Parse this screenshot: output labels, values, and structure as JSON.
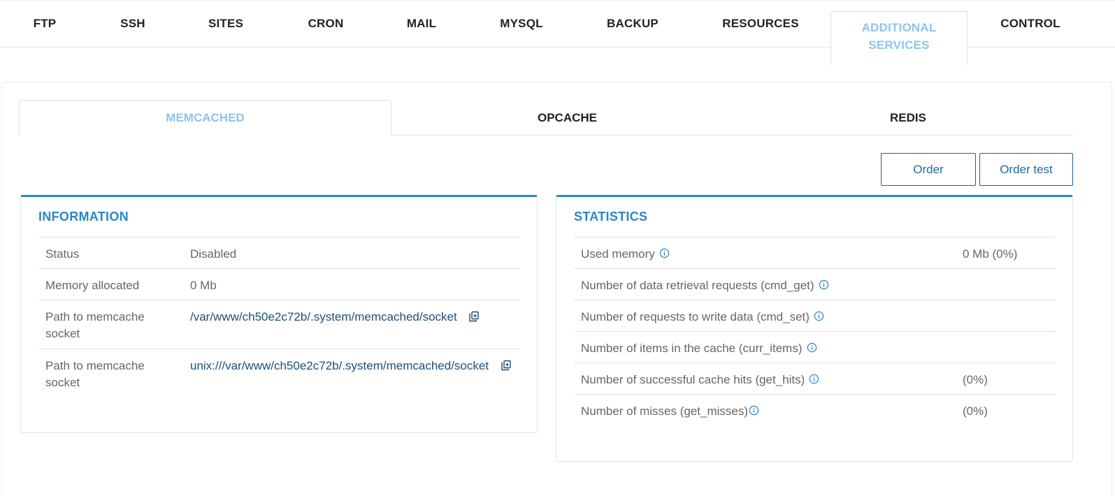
{
  "top_tabs": [
    {
      "label": "FTP"
    },
    {
      "label": "SSH"
    },
    {
      "label": "SITES"
    },
    {
      "label": "CRON"
    },
    {
      "label": "MAIL"
    },
    {
      "label": "MYSQL"
    },
    {
      "label": "BACKUP"
    },
    {
      "label": "RESOURCES"
    },
    {
      "label_line1": "ADDITIONAL",
      "label_line2": "SERVICES",
      "active": true
    },
    {
      "label": "CONTROL"
    }
  ],
  "sub_tabs": [
    {
      "label": "MEMCACHED",
      "active": true
    },
    {
      "label": "OPCACHE"
    },
    {
      "label": "REDIS"
    }
  ],
  "actions": {
    "order_label": "Order",
    "order_test_label": "Order test"
  },
  "information": {
    "title": "INFORMATION",
    "rows": [
      {
        "label": "Status",
        "value": "Disabled"
      },
      {
        "label": "Memory allocated",
        "value": "0 Mb"
      },
      {
        "label_line1": "Path to memcache",
        "label_line2": "socket",
        "value": "/var/www/ch50e2c72b/.system/memcached/socket"
      },
      {
        "label_line1": "Path to memcache",
        "label_line2": "socket",
        "value": "unix:///var/www/ch50e2c72b/.system/memcached/socket"
      }
    ]
  },
  "statistics": {
    "title": "STATISTICS",
    "rows": [
      {
        "label": "Used memory",
        "value": "0 Mb (0%)"
      },
      {
        "label": "Number of data retrieval requests (cmd_get)",
        "value": ""
      },
      {
        "label": "Number of requests to write data (cmd_set)",
        "value": ""
      },
      {
        "label": "Number of items in the cache (curr_items)",
        "value": ""
      },
      {
        "label": "Number of successful cache hits (get_hits)",
        "value": "(0%)"
      },
      {
        "label": "Number of misses (get_misses)",
        "value": "(0%)"
      }
    ]
  },
  "colors": {
    "accent": "#2b86c8",
    "active_tab_text": "#8ec4ec",
    "link": "#1d4f78",
    "button_border": "#1f5f8a"
  },
  "icons": [
    "copy-icon",
    "info-icon"
  ]
}
